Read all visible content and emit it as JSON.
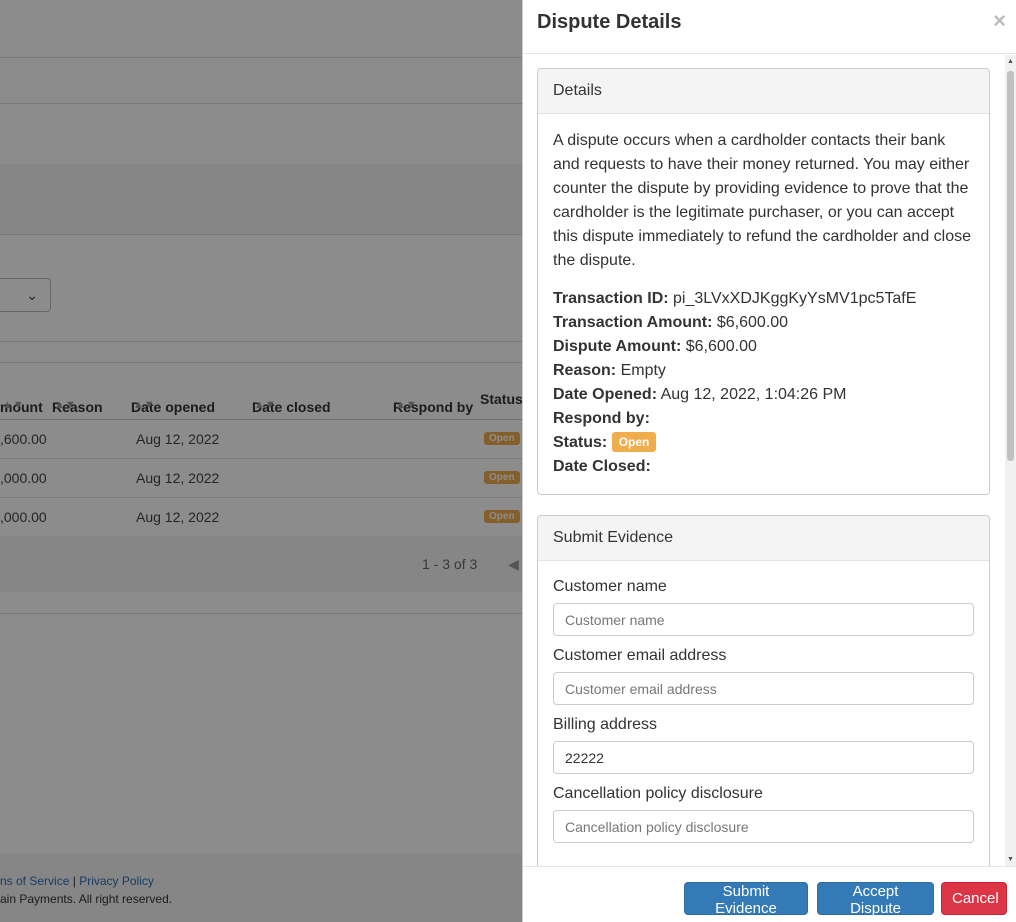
{
  "background": {
    "table": {
      "headers": [
        "mount",
        "Reason",
        "Date opened",
        "Date closed",
        "Respond by",
        "Status"
      ],
      "rows": [
        {
          "amount": ",600.00",
          "date_opened": "Aug 12, 2022",
          "status": "Open"
        },
        {
          "amount": ",000.00",
          "date_opened": "Aug 12, 2022",
          "status": "Open"
        },
        {
          "amount": ",000.00",
          "date_opened": "Aug 12, 2022",
          "status": "Open"
        }
      ],
      "pager": "1 - 3 of 3"
    },
    "footer": {
      "terms": "ns of Service",
      "separator": "|",
      "privacy": "Privacy Policy",
      "copyright": "ain Payments. All right reserved."
    }
  },
  "drawer": {
    "title": "Dispute Details",
    "close_icon": "×",
    "details": {
      "heading": "Details",
      "description": "A dispute occurs when a cardholder contacts their bank and requests to have their money returned. You may either counter the dispute by providing evidence to prove that the cardholder is the legitimate purchaser, or you can accept this dispute immediately to refund the cardholder and close the dispute.",
      "fields": {
        "transaction_id": {
          "label": "Transaction ID:",
          "value": "pi_3LVxXDJKggKyYsMV1pc5TafE"
        },
        "transaction_amount": {
          "label": "Transaction Amount:",
          "value": "$6,600.00"
        },
        "dispute_amount": {
          "label": "Dispute Amount:",
          "value": "$6,600.00"
        },
        "reason": {
          "label": "Reason:",
          "value": "Empty"
        },
        "date_opened": {
          "label": "Date Opened:",
          "value": "Aug 12, 2022, 1:04:26 PM"
        },
        "respond_by": {
          "label": "Respond by:",
          "value": ""
        },
        "status": {
          "label": "Status:",
          "value": "Open"
        },
        "date_closed": {
          "label": "Date Closed:",
          "value": ""
        }
      }
    },
    "evidence": {
      "heading": "Submit Evidence",
      "customer_name": {
        "label": "Customer name",
        "placeholder": "Customer name",
        "value": ""
      },
      "customer_email": {
        "label": "Customer email address",
        "placeholder": "Customer email address",
        "value": ""
      },
      "billing_address": {
        "label": "Billing address",
        "placeholder": "Billing address",
        "value": "22222"
      },
      "cancellation_policy": {
        "label": "Cancellation policy disclosure",
        "placeholder": "Cancellation policy disclosure",
        "value": ""
      }
    },
    "footer": {
      "submit_label": "Submit Evidence",
      "accept_label": "Accept Dispute",
      "cancel_label": "Cancel"
    }
  },
  "colors": {
    "primary": "#337ab7",
    "danger": "#dc3545",
    "warning_badge": "#f0ad4e"
  }
}
